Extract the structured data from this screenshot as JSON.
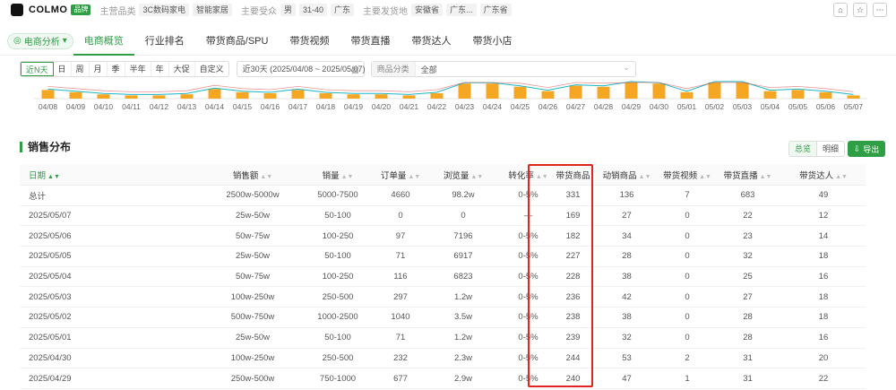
{
  "header": {
    "brand": "COLMO",
    "badge": "品牌",
    "main_category_label": "主营品类",
    "main_category_tags": [
      "3C数码家电",
      "智能家居"
    ],
    "audience_label": "主要受众",
    "audience_tags": [
      "男",
      "31-40",
      "广东"
    ],
    "ship_label": "主要发货地",
    "ship_tags": [
      "安徽省",
      "广东...",
      "广东省"
    ]
  },
  "nav": {
    "dropdown": "电商分析",
    "items": [
      "电商概览",
      "行业排名",
      "带货商品/SPU",
      "带货视频",
      "带货直播",
      "带货达人",
      "带货小店"
    ],
    "active": "电商概览"
  },
  "filters": {
    "periods": [
      "近N天",
      "日",
      "周",
      "月",
      "季",
      "半年",
      "年",
      "大促",
      "自定义"
    ],
    "active_period": "近N天",
    "date_range": "近30天 (2025/04/08 ~ 2025/05/07)",
    "category_label": "商品分类",
    "category_value": "全部"
  },
  "chart_data": {
    "type": "bar",
    "categories": [
      "04/08",
      "04/09",
      "04/10",
      "04/11",
      "04/12",
      "04/13",
      "04/14",
      "04/15",
      "04/16",
      "04/17",
      "04/18",
      "04/19",
      "04/20",
      "04/21",
      "04/22",
      "04/23",
      "04/24",
      "04/25",
      "04/26",
      "04/27",
      "04/28",
      "04/29",
      "04/30",
      "05/01",
      "05/02",
      "05/03",
      "05/04",
      "05/05",
      "05/06",
      "05/07"
    ],
    "values": [
      8,
      6,
      4,
      3,
      3,
      4,
      9,
      6,
      5,
      8,
      5,
      4,
      4,
      3,
      5,
      14,
      14,
      11,
      7,
      12,
      11,
      15,
      14,
      6,
      15,
      15,
      7,
      8,
      6,
      3
    ],
    "colors": {
      "bar": "#f5a623",
      "line": "#1ab5c9",
      "accent_line": "#e05050"
    }
  },
  "section": {
    "title": "销售分布",
    "view_options": [
      "总览",
      "明细"
    ],
    "active_view": "总览",
    "export": "导出"
  },
  "table": {
    "columns": [
      "日期",
      "销售额",
      "销量",
      "订单量",
      "浏览量",
      "转化率",
      "带货商品",
      "动销商品",
      "带货视频",
      "带货直播",
      "带货达人"
    ],
    "rows": [
      [
        "总计",
        "2500w-5000w",
        "5000-7500",
        "4660",
        "98.2w",
        "0-5%",
        "331",
        "136",
        "7",
        "683",
        "49"
      ],
      [
        "2025/05/07",
        "25w-50w",
        "50-100",
        "0",
        "0",
        "—",
        "169",
        "27",
        "0",
        "22",
        "12"
      ],
      [
        "2025/05/06",
        "50w-75w",
        "100-250",
        "97",
        "7196",
        "0-5%",
        "182",
        "34",
        "0",
        "23",
        "14"
      ],
      [
        "2025/05/05",
        "25w-50w",
        "50-100",
        "71",
        "6917",
        "0-5%",
        "227",
        "28",
        "0",
        "32",
        "18"
      ],
      [
        "2025/05/04",
        "50w-75w",
        "100-250",
        "116",
        "6823",
        "0-5%",
        "228",
        "38",
        "0",
        "25",
        "16"
      ],
      [
        "2025/05/03",
        "100w-250w",
        "250-500",
        "297",
        "1.2w",
        "0-5%",
        "236",
        "42",
        "0",
        "27",
        "18"
      ],
      [
        "2025/05/02",
        "500w-750w",
        "1000-2500",
        "1040",
        "3.5w",
        "0-5%",
        "238",
        "38",
        "0",
        "28",
        "18"
      ],
      [
        "2025/05/01",
        "25w-50w",
        "50-100",
        "71",
        "1.2w",
        "0-5%",
        "239",
        "32",
        "0",
        "28",
        "16"
      ],
      [
        "2025/04/30",
        "100w-250w",
        "250-500",
        "232",
        "2.3w",
        "0-5%",
        "244",
        "53",
        "2",
        "31",
        "20"
      ],
      [
        "2025/04/29",
        "250w-500w",
        "750-1000",
        "677",
        "2.9w",
        "0-5%",
        "240",
        "47",
        "1",
        "31",
        "22"
      ]
    ]
  }
}
